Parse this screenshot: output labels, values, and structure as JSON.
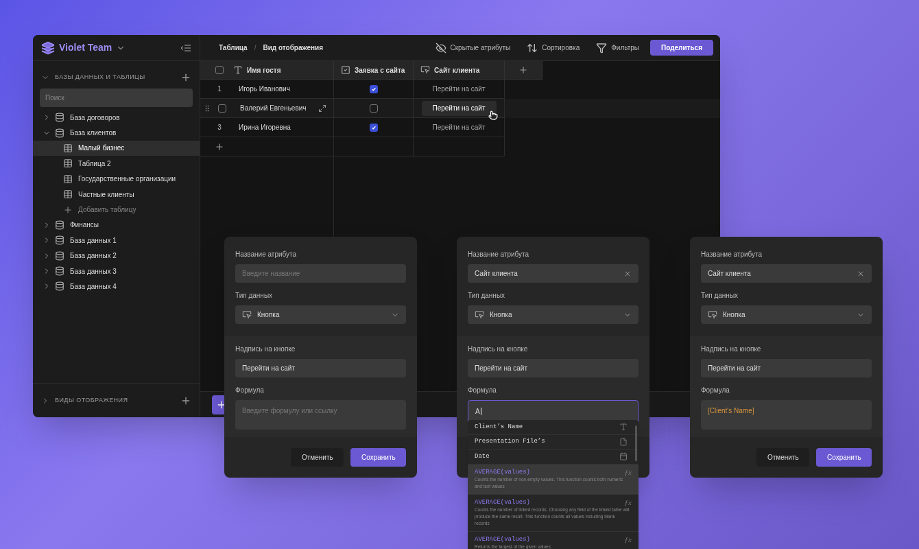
{
  "workspace": {
    "name": "Violet Team"
  },
  "breadcrumb": [
    "Таблица",
    "Вид отображения"
  ],
  "breadcrumb_separator": "/",
  "toolbar": [
    {
      "kind": "hidden",
      "label": "Скрытые атрибуты"
    },
    {
      "kind": "sort",
      "label": "Сортировка"
    },
    {
      "kind": "filter",
      "label": "Фильтры"
    }
  ],
  "share_button": "Поделиться",
  "sidebar": {
    "section_title": "БАЗЫ ДАННЫХ И ТАБЛИЦЫ",
    "search": {
      "placeholder": "Поиск"
    },
    "items": [
      {
        "label": "База договоров",
        "expanded": false
      },
      {
        "label": "База клиентов",
        "expanded": true,
        "children": [
          {
            "kind": "table",
            "label": "Малый бизнес",
            "selected": true
          },
          {
            "kind": "table",
            "label": "Таблица 2",
            "selected": false
          },
          {
            "kind": "table",
            "label": "Государственные организации",
            "selected": false
          },
          {
            "kind": "table",
            "label": "Частные клиенты",
            "selected": false
          },
          {
            "kind": "add",
            "label": "Добавить таблицу",
            "selected": false
          }
        ]
      },
      {
        "label": "Финансы",
        "expanded": false
      },
      {
        "label": "База данных 1",
        "expanded": false
      },
      {
        "label": "База данных 2",
        "expanded": false
      },
      {
        "label": "База данных 3",
        "expanded": false
      },
      {
        "label": "База данных 4",
        "expanded": false
      }
    ],
    "footer_section": "ВИДЫ ОТОБРАЖЕНИЯ"
  },
  "table": {
    "all_selected": false,
    "columns": [
      {
        "kind": "text",
        "label": "Имя гостя"
      },
      {
        "kind": "checkbox",
        "label": "Заявка с сайта"
      },
      {
        "kind": "button",
        "label": "Сайт клиента"
      }
    ],
    "rows": [
      {
        "number": "1",
        "name": "Игорь Иванович",
        "checked": true,
        "button": "Перейти на сайт",
        "hovered": false
      },
      {
        "name": "Валерий Евгеньевич",
        "checked": false,
        "button": "Перейти на сайт",
        "hovered": true
      },
      {
        "number": "3",
        "name": "Ирина Игоревна",
        "checked": true,
        "button": "Перейти на сайт",
        "hovered": false
      }
    ]
  },
  "panels": [
    {
      "name_label": "Название атрибута",
      "name": {
        "placeholder": "Введите название"
      },
      "type_label": "Тип данных",
      "type_value": "Кнопка",
      "caption_label": "Надпись на кнопке",
      "caption_value": "Перейти на сайт",
      "formula_label": "Формула",
      "formula": {
        "kind": "empty",
        "placeholder": "Введите формулу или ссылку"
      },
      "buttons": [
        {
          "kind": "secondary",
          "label": "Отменить"
        },
        {
          "kind": "primary",
          "label": "Сохранить"
        }
      ]
    },
    {
      "name_label": "Название атрибута",
      "name": {
        "value": "Сайт клиента"
      },
      "type_label": "Тип данных",
      "type_value": "Кнопка",
      "caption_label": "Надпись на кнопке",
      "caption_value": "Перейти на сайт",
      "formula_label": "Формула",
      "formula": {
        "kind": "typing",
        "value": "A"
      },
      "suggestions": [
        {
          "kind": "text_field",
          "label": "Client’s Name",
          "selected": false
        },
        {
          "kind": "file_field",
          "label": "Presentation File’s",
          "selected": false
        },
        {
          "kind": "date_field",
          "label": "Date",
          "selected": false
        },
        {
          "kind": "function",
          "label": "AVERAGE(values)",
          "symbol": "ƒx",
          "description": "Counts the number of non-empty values. This function counts both numeric and text values",
          "selected": true
        },
        {
          "kind": "function",
          "label": "AVERAGE(values)",
          "symbol": "ƒx",
          "description": "Counts the number of linked records. Choosing any field of the linked table will produce the same result. This function counts all values including blank records",
          "selected": false
        },
        {
          "kind": "function",
          "label": "AVERAGE(values)",
          "symbol": "ƒx",
          "description": "Returns the largest of the given values",
          "selected": false
        }
      ]
    },
    {
      "name_label": "Название атрибута",
      "name": {
        "value": "Сайт клиента"
      },
      "type_label": "Тип данных",
      "type_value": "Кнопка",
      "caption_label": "Надпись на кнопке",
      "caption_value": "Перейти на сайт",
      "formula_label": "Формула",
      "formula": {
        "kind": "reference",
        "value": "[Client's Name]"
      },
      "buttons": [
        {
          "kind": "secondary",
          "label": "Отменить"
        },
        {
          "kind": "primary",
          "label": "Сохранить"
        }
      ]
    }
  ]
}
